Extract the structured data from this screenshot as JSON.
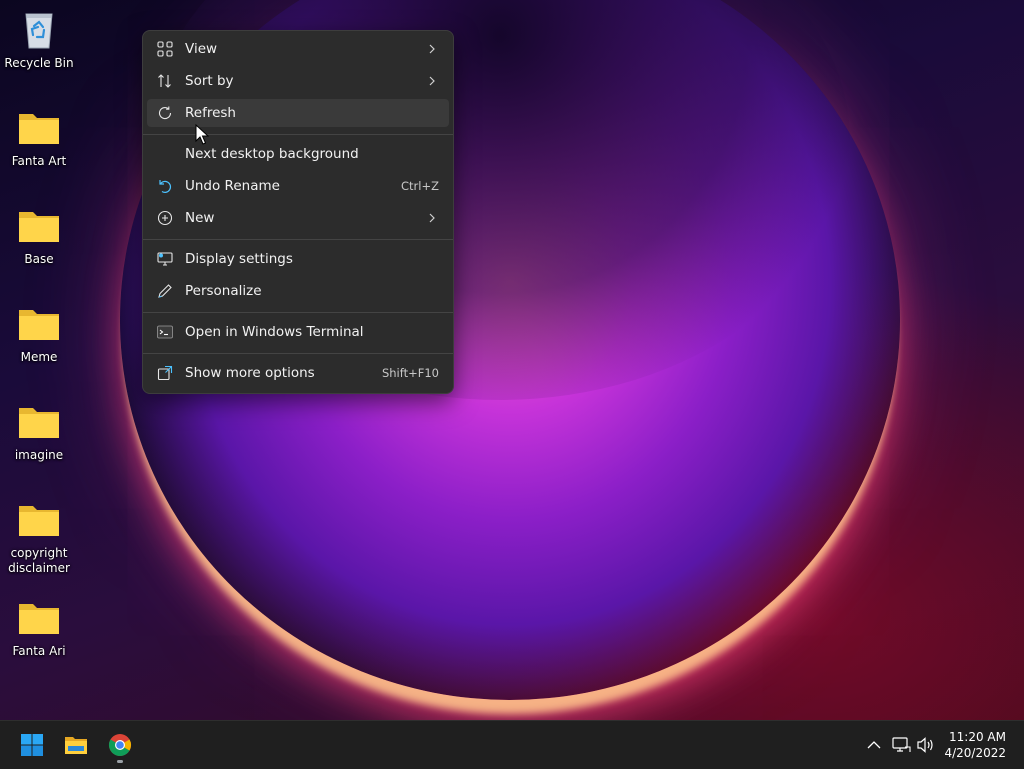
{
  "desktop": {
    "icons": [
      {
        "label": "Recycle Bin",
        "icon": "recycle-bin-icon"
      },
      {
        "label": "Fanta Art",
        "icon": "folder-icon"
      },
      {
        "label": "Base",
        "icon": "folder-icon"
      },
      {
        "label": "Meme",
        "icon": "folder-icon"
      },
      {
        "label": "imagine",
        "icon": "folder-icon"
      },
      {
        "label": "copyright disclaimer",
        "icon": "folder-icon"
      },
      {
        "label": "Fanta Ari",
        "icon": "folder-icon"
      }
    ]
  },
  "context_menu": {
    "items": [
      {
        "label": "View",
        "icon": "grid-icon",
        "submenu": true
      },
      {
        "label": "Sort by",
        "icon": "sort-icon",
        "submenu": true
      },
      {
        "label": "Refresh",
        "icon": "refresh-icon",
        "hovered": true
      },
      {
        "label": "Next desktop background",
        "icon": ""
      },
      {
        "label": "Undo Rename",
        "icon": "undo-icon",
        "shortcut": "Ctrl+Z"
      },
      {
        "label": "New",
        "icon": "plus-circle-icon",
        "submenu": true
      },
      {
        "label": "Display settings",
        "icon": "display-icon"
      },
      {
        "label": "Personalize",
        "icon": "pen-icon"
      },
      {
        "label": "Open in Windows Terminal",
        "icon": "terminal-icon"
      },
      {
        "label": "Show more options",
        "icon": "more-options-icon",
        "shortcut": "Shift+F10"
      }
    ]
  },
  "taskbar": {
    "apps": [
      {
        "name": "Start",
        "icon": "windows-start-icon"
      },
      {
        "name": "File Explorer",
        "icon": "file-explorer-icon"
      },
      {
        "name": "Google Chrome",
        "icon": "chrome-icon",
        "active": true
      }
    ],
    "tray": [
      "chevron-up-icon",
      "network-icon",
      "volume-icon"
    ],
    "time": "11:20 AM",
    "date": "4/20/2022"
  },
  "colors": {
    "menu_bg": "#2c2c2c",
    "menu_hover": "#3a3a3a",
    "taskbar_bg": "#1f1f1f",
    "accent_blue": "#4cc2ff"
  }
}
